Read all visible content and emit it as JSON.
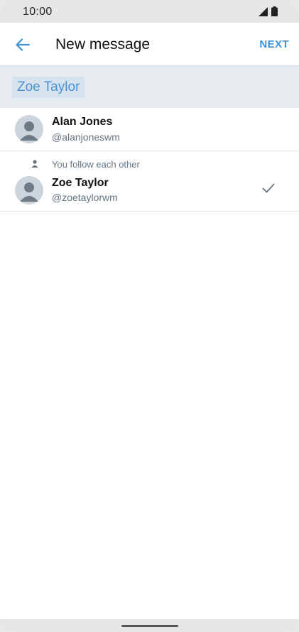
{
  "status_bar": {
    "time": "10:00"
  },
  "header": {
    "title": "New message",
    "next_label": "NEXT"
  },
  "recipients": {
    "chips": [
      "Zoe Taylor"
    ]
  },
  "users": [
    {
      "name": "Alan Jones",
      "handle": "@alanjoneswm",
      "context": "",
      "selected": false
    },
    {
      "name": "Zoe Taylor",
      "handle": "@zoetaylorwm",
      "context": "You follow each other",
      "selected": true
    }
  ],
  "colors": {
    "accent": "#3b94d9",
    "chip_bg": "#d6e3ee",
    "recipients_bg": "#e6ecf0",
    "secondary_text": "#667580"
  },
  "icons": {
    "back": "arrow-left-icon",
    "avatar": "default-avatar-icon",
    "follow": "person-icon",
    "selected": "checkmark-icon",
    "signal": "signal-icon",
    "battery": "battery-icon"
  }
}
